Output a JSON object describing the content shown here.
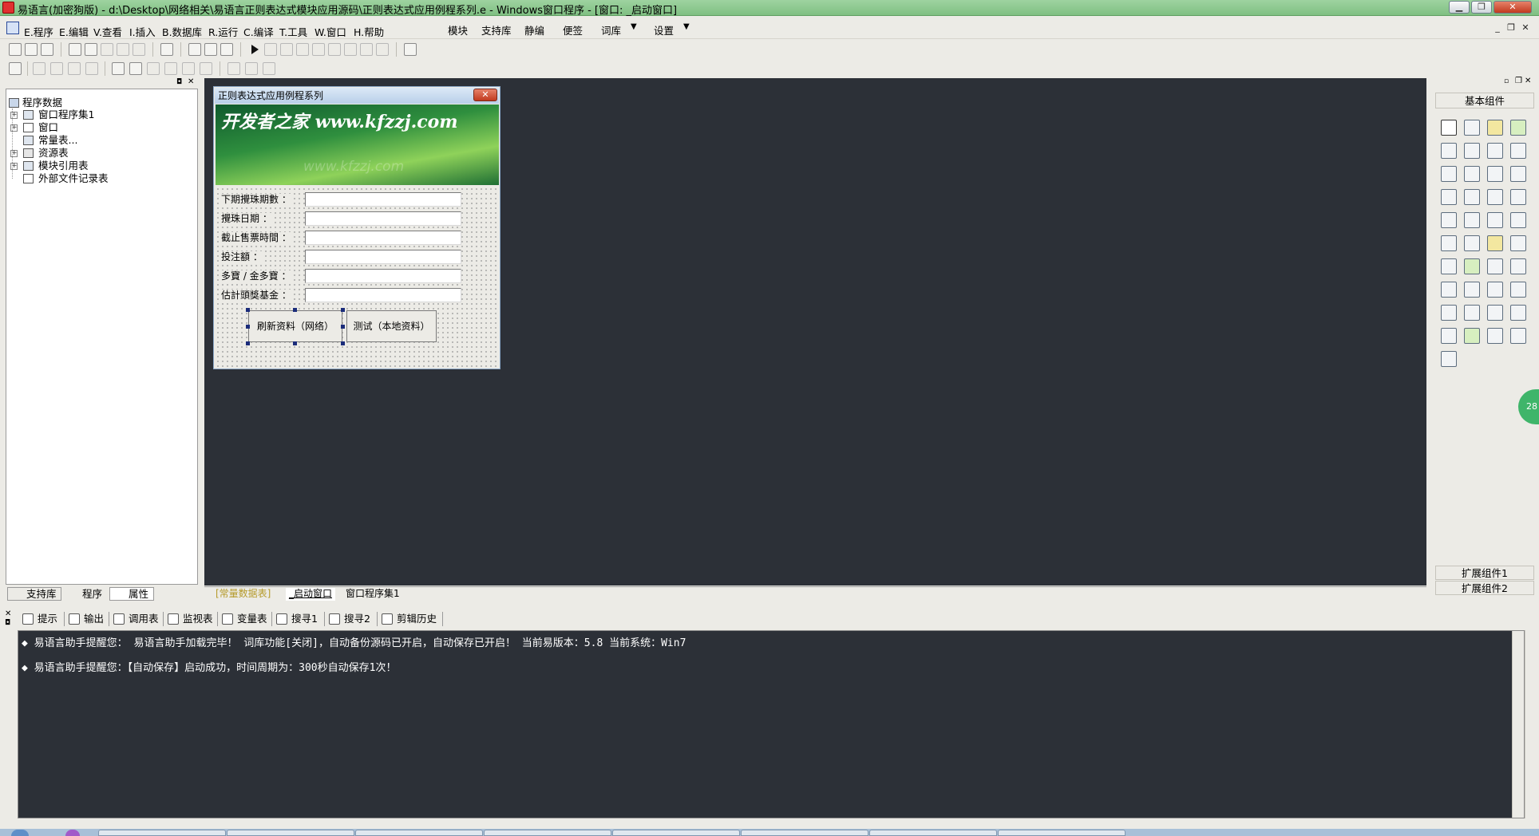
{
  "window": {
    "title": "易语言(加密狗版) - d:\\Desktop\\网络相关\\易语言正则表达式模块应用源码\\正则表达式应用例程系列.e - Windows窗口程序 - [窗口: _启动窗口]"
  },
  "menu": {
    "items": [
      "E.程序",
      "E.编辑",
      "V.查看",
      "I.插入",
      "B.数据库",
      "R.运行",
      "C.编译",
      "T.工具",
      "W.窗口",
      "H.帮助"
    ],
    "extra": [
      "模块",
      "支持库",
      "静编",
      "便签",
      "词库",
      "设置"
    ]
  },
  "left_panel": {
    "root": "程序数据",
    "items": [
      "窗口程序集1",
      "窗口",
      "常量表...",
      "资源表",
      "模块引用表",
      "外部文件记录表"
    ],
    "tabs": [
      "支持库",
      "程序",
      "属性"
    ]
  },
  "design_window": {
    "title": "正则表达式应用例程系列",
    "close_label": "✕",
    "banner_text": "开发者之家 www.kfzzj.com",
    "banner_ghost": "www.kfzzj.com",
    "labels": [
      "下期攪珠期數 ：",
      "攪珠日期 ：",
      "截止售票時間 ：",
      "投注額 ：",
      "多寶 / 金多寶 ：",
      "估計頭獎基金 ："
    ],
    "buttons": [
      "刷新资料（网络）",
      "测试（本地资料）"
    ]
  },
  "center_tabs": [
    "[常量数据表]",
    "_启动窗口",
    "窗口程序集1"
  ],
  "right_panel": {
    "title": "基本组件",
    "extensions": [
      "扩展组件1",
      "扩展组件2"
    ],
    "badge": "28"
  },
  "bottom_tabs": [
    "提示",
    "输出",
    "调用表",
    "监视表",
    "变量表",
    "搜寻1",
    "搜寻2",
    "剪辑历史"
  ],
  "output_lines": [
    "◆ 易语言助手提醒您： 易语言助手加载完毕！ 词库功能[关闭]，自动备份源码已开启，自动保存已开启！ 当前易版本：5.8  当前系统：Win7",
    "◆ 易语言助手提醒您：【自动保存】启动成功，时间周期为：300秒自动保存1次！"
  ],
  "colors": {
    "workspace": "#2c3037",
    "titlebar": "#8fc892",
    "banner": "#2f8f3e"
  }
}
